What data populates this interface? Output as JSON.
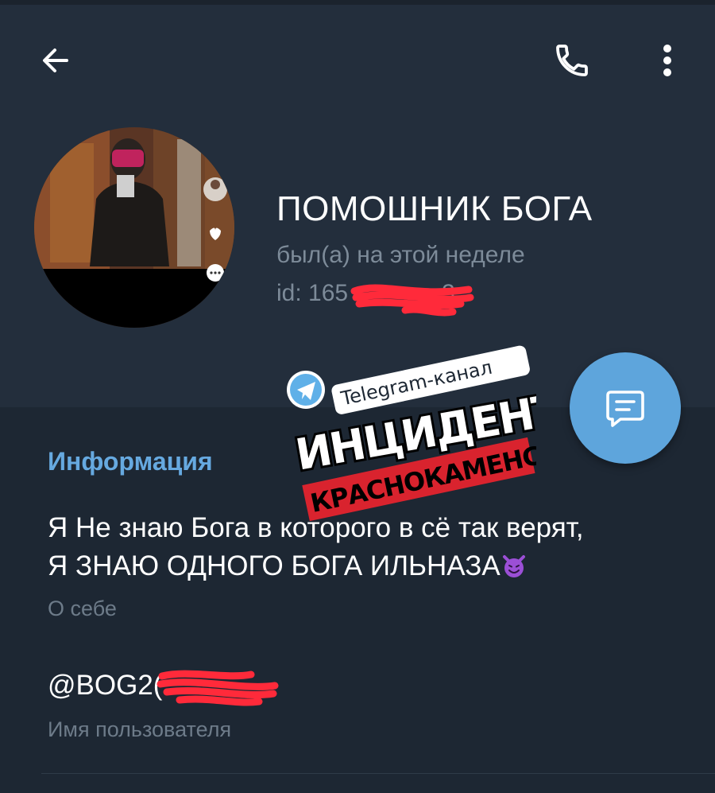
{
  "header": {
    "back_icon": "arrow-left-icon",
    "call_icon": "phone-icon",
    "more_icon": "more-vertical-icon"
  },
  "profile": {
    "name": "ПОМОШНИК БОГА",
    "status": "был(а) на этой неделе",
    "id_text": "id: 165",
    "id_suffix": "3"
  },
  "fab": {
    "icon": "message-icon",
    "color": "#5ea5dc"
  },
  "info": {
    "section_title": "Информация",
    "bio_line1": "Я Не знаю Бога в которого в сё так верят,",
    "bio_line2": "Я ЗНАЮ ОДНОГО БОГА ИЛЬНАЗА",
    "bio_emoji": "smiling-devil-emoji",
    "bio_label": "О себе",
    "username": "@BOG2(",
    "username_label": "Имя пользователя"
  },
  "watermark": {
    "top_text": "Telegram-канал",
    "main_text": "ИНЦИДЕНТ",
    "bottom_text": "КРАСНОКАМЕНСК"
  },
  "colors": {
    "background": "#1d2733",
    "header_background": "#232e3c",
    "accent": "#66a9e0",
    "secondary_text": "#7d8b99",
    "redaction": "#ff2a3a"
  }
}
